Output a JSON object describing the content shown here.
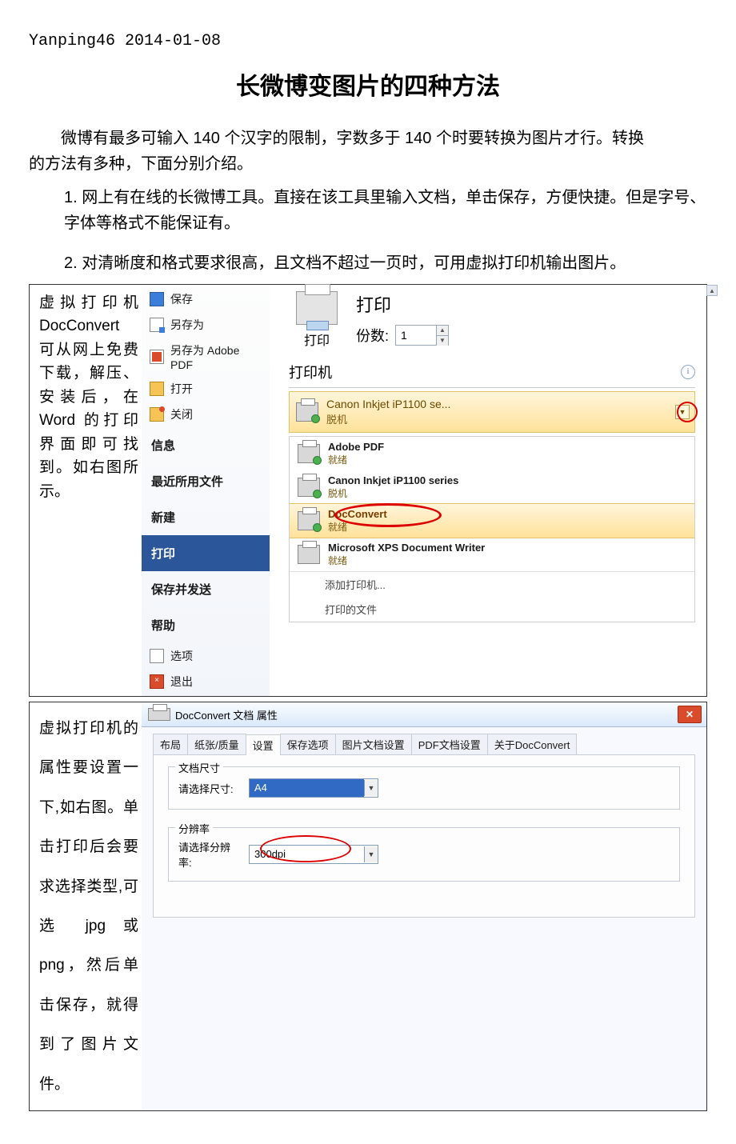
{
  "header": "Yanping46  2014-01-08",
  "title": "长微博变图片的四种方法",
  "intro_a": "微博有最多可输入 140 个汉字的限制，字数多于 140 个时要转换为图片才行。转换",
  "intro_b": "的方法有多种，下面分别介绍。",
  "item1": "1. 网上有在线的长微博工具。直接在该工具里输入文档，单击保存，方便快捷。但是字号、字体等格式不能保证有。",
  "item2": "2. 对清晰度和格式要求很高，且文档不超过一页时，可用虚拟打印机输出图片。",
  "left1": "虚拟打印机 DocConvert 可从网上免费下载，解压、安装后，在 Word 的打印界面即可找到。如右图所示。",
  "left2": "虚拟打印机的属性要设置一下,如右图。单击打印后会要求选择类型,可选 jpg 或 png，然后单击保存，就得到了图片文件。",
  "file_menu": {
    "save": "保存",
    "save_as": "另存为",
    "save_pdf": "另存为 Adobe PDF",
    "open": "打开",
    "close": "关闭",
    "info": "信息",
    "recent": "最近所用文件",
    "new": "新建",
    "print": "打印",
    "save_send": "保存并发送",
    "help": "帮助",
    "options": "选项",
    "exit": "退出"
  },
  "print": {
    "heading": "打印",
    "copies_lbl": "份数:",
    "copies_val": "1",
    "btn": "打印",
    "section": "打印机",
    "selected_name": "Canon Inkjet iP1100 se...",
    "selected_status": "脱机",
    "list": [
      {
        "name": "Adobe PDF",
        "status": "就绪"
      },
      {
        "name": "Canon Inkjet iP1100 series",
        "status": "脱机"
      },
      {
        "name": "DocConvert",
        "status": "就绪",
        "hl": true
      },
      {
        "name": "Microsoft XPS Document Writer",
        "status": "就绪"
      }
    ],
    "add": "添加打印机...",
    "files": "打印的文件"
  },
  "dlg": {
    "title": "DocConvert 文档 属性",
    "tabs": [
      "布局",
      "纸张/质量",
      "设置",
      "保存选项",
      "图片文档设置",
      "PDF文档设置",
      "关于DocConvert"
    ],
    "active_tab": 2,
    "size_group": "文档尺寸",
    "size_lbl": "请选择尺寸:",
    "size_val": "A4",
    "dpi_group": "分辨率",
    "dpi_lbl": "请选择分辨率:",
    "dpi_val": "300dpi"
  }
}
